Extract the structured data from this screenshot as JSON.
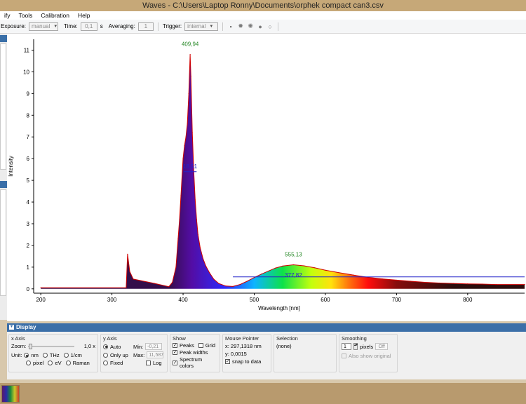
{
  "window": {
    "title": "Waves  -  C:\\Users\\Laptop Ronny\\Documents\\orphek compact can3.csv"
  },
  "menu": [
    "ify",
    "Tools",
    "Calibration",
    "Help"
  ],
  "toolbar": {
    "exposure_label": "Exposure:",
    "exposure_value": "manual",
    "time_label": "Time:",
    "time_value": "0,1",
    "time_unit": "s",
    "averaging_label": "Averaging:",
    "averaging_value": "1",
    "trigger_label": "Trigger:",
    "trigger_value": "internal",
    "icons": [
      "save-icon",
      "sun-icon",
      "sun-outline-icon",
      "record-dot-icon",
      "record-ring-icon"
    ]
  },
  "chart_data": {
    "type": "line",
    "xlabel": "Wavelength [nm]",
    "ylabel": "Intensity",
    "xlim": [
      190,
      880
    ],
    "ylim": [
      -0.2,
      11.5
    ],
    "xticks": [
      200,
      300,
      400,
      500,
      600,
      700,
      800
    ],
    "yticks": [
      0,
      1,
      2,
      3,
      4,
      5,
      6,
      7,
      8,
      9,
      10,
      11
    ],
    "grid": false,
    "colors": {
      "line": "#d00000",
      "peak_label": "#2a8a2a",
      "width_label": "#2323c8"
    },
    "series": [
      {
        "x": [
          200,
          320,
          322,
          325,
          330,
          360,
          380,
          385,
          390,
          393,
          395,
          397,
          400,
          402,
          404,
          406,
          408,
          409.94,
          411,
          413,
          415,
          417,
          419,
          421,
          424,
          428,
          432,
          437,
          443,
          450,
          460,
          470,
          480,
          490,
          500,
          510,
          520,
          530,
          540,
          555.13,
          570,
          585,
          600,
          620,
          640,
          660,
          680,
          700,
          720,
          740,
          760,
          780,
          800,
          820,
          840,
          880
        ],
        "y": [
          0.05,
          0.05,
          1.6,
          0.8,
          0.45,
          0.25,
          0.1,
          0.3,
          1.0,
          2.3,
          3.2,
          4.3,
          6.0,
          6.6,
          7.0,
          7.6,
          9.0,
          10.8,
          9.8,
          7.2,
          5.4,
          4.1,
          3.2,
          2.5,
          1.9,
          1.4,
          1.05,
          0.75,
          0.45,
          0.25,
          0.13,
          0.11,
          0.2,
          0.35,
          0.52,
          0.68,
          0.82,
          0.96,
          1.05,
          1.11,
          1.06,
          0.97,
          0.86,
          0.74,
          0.63,
          0.53,
          0.46,
          0.4,
          0.35,
          0.3,
          0.27,
          0.25,
          0.23,
          0.22,
          0.2,
          0.2
        ]
      }
    ],
    "annotations": [
      {
        "text": "409,94",
        "x": 409.94,
        "y": 11.2,
        "kind": "peak"
      },
      {
        "text": "555,13",
        "x": 555.13,
        "y": 1.5,
        "kind": "peak"
      },
      {
        "text": "377,82",
        "x": 555.13,
        "y": 0.55,
        "kind": "width"
      },
      {
        "text": "18,51",
        "x": 409.94,
        "y": 5.55,
        "kind": "width"
      }
    ],
    "width_lines": [
      {
        "x1": 401,
        "x2": 419,
        "y": 5.4
      },
      {
        "x1": 470,
        "x2": 880,
        "y": 0.55
      }
    ]
  },
  "display": {
    "header": "Display",
    "x_axis": {
      "title": "x Axis",
      "zoom_label": "Zoom:",
      "zoom_value": "1,0 x",
      "unit_label": "Unit:",
      "units": [
        "nm",
        "THz",
        "1/cm",
        "pixel",
        "eV",
        "Raman"
      ],
      "selected_unit": "nm"
    },
    "y_axis": {
      "title": "y Axis",
      "options": [
        "Auto",
        "Only up",
        "Fixed"
      ],
      "selected": "Auto",
      "min_label": "Min:",
      "min_value": "-0,21",
      "max_label": "Max:",
      "max_value": "11,587",
      "log_label": "Log"
    },
    "show": {
      "title": "Show",
      "peaks": "Peaks",
      "grid": "Grid",
      "peak_widths": "Peak widths",
      "spectrum_colors": "Spectrum colors"
    },
    "mouse_pointer": {
      "title": "Mouse Pointer",
      "x_text": "x: 297,1318 nm",
      "y_text": "y: 0,0015",
      "snap_label": "snap to data"
    },
    "selection": {
      "title": "Selection",
      "value": "(none)"
    },
    "smoothing": {
      "title": "Smoothing",
      "value": "1",
      "unit": "pixels",
      "off_label": "Off",
      "also_label": "Also show original"
    }
  }
}
